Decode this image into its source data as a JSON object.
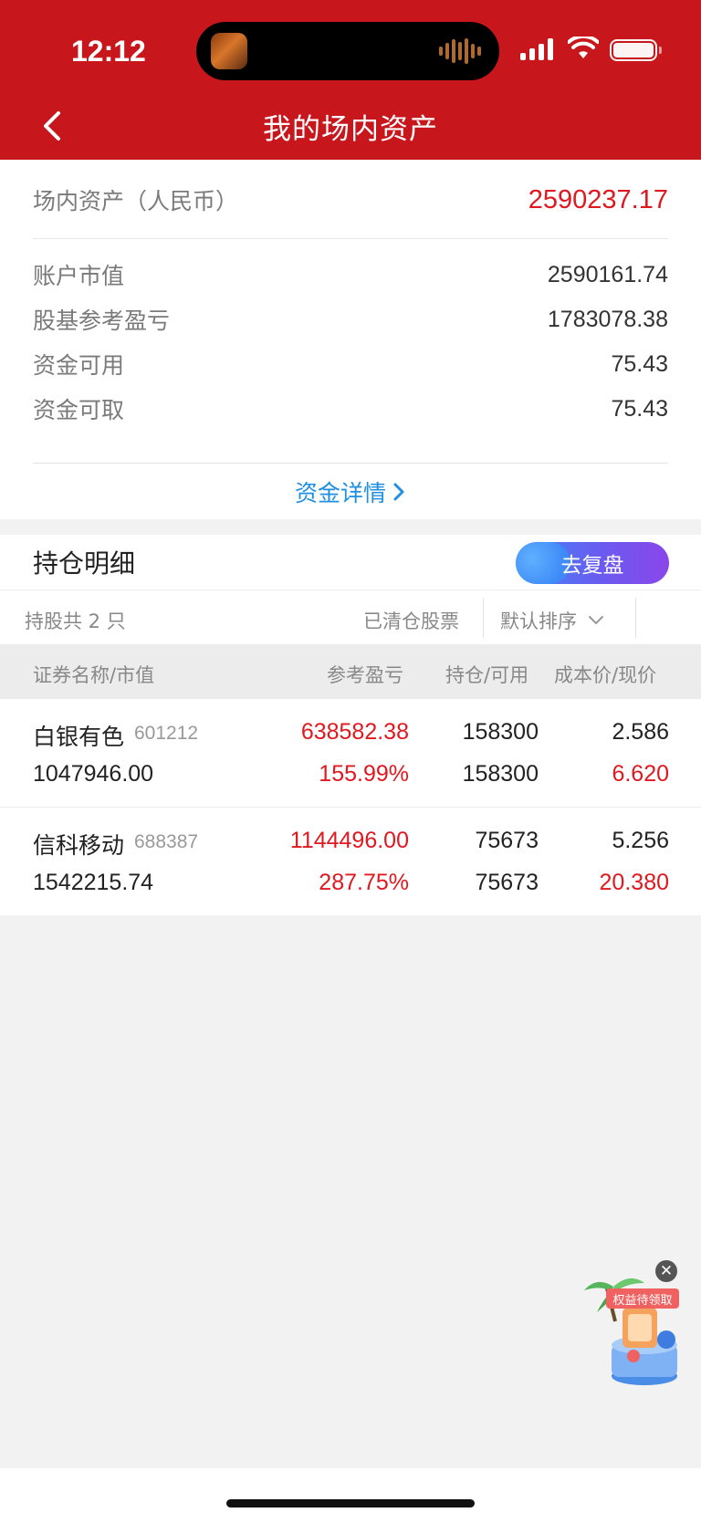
{
  "status_bar": {
    "time": "12:12",
    "icons": [
      "app-activity-icon",
      "audio-wave-icon",
      "signal-icon",
      "wifi-icon",
      "battery-icon"
    ]
  },
  "nav": {
    "title": "我的场内资产",
    "back_icon": "chevron-left-icon"
  },
  "asset": {
    "header_label": "场内资产（人民币）",
    "header_value": "2590237.17",
    "rows": [
      {
        "label": "账户市值",
        "value": "2590161.74"
      },
      {
        "label": "股基参考盈亏",
        "value": "1783078.38"
      },
      {
        "label": "资金可用",
        "value": "75.43"
      },
      {
        "label": "资金可取",
        "value": "75.43"
      }
    ],
    "detail_link": "资金详情"
  },
  "holdings": {
    "title": "持仓明细",
    "review_button": "去复盘",
    "count": "持股共 2 只",
    "cleared": "已清仓股票",
    "sort": "默认排序",
    "columns": [
      "证券名称/市值",
      "参考盈亏",
      "持仓/可用",
      "成本价/现价"
    ],
    "stocks": [
      {
        "name": "白银有色",
        "code": "601212",
        "market_value": "1047946.00",
        "pnl": "638582.38",
        "pnl_pct": "155.99%",
        "position": "158300",
        "available": "158300",
        "cost": "2.586",
        "price": "6.620"
      },
      {
        "name": "信科移动",
        "code": "688387",
        "market_value": "1542215.74",
        "pnl": "1144496.00",
        "pnl_pct": "287.75%",
        "position": "75673",
        "available": "75673",
        "cost": "5.256",
        "price": "20.380"
      }
    ]
  },
  "promo": {
    "tag": "权益待领取",
    "close_icon": "close-icon"
  },
  "colors": {
    "brand_red": "#c8161d",
    "profit_red": "#e0181f",
    "link_blue": "#1f8fe0"
  }
}
